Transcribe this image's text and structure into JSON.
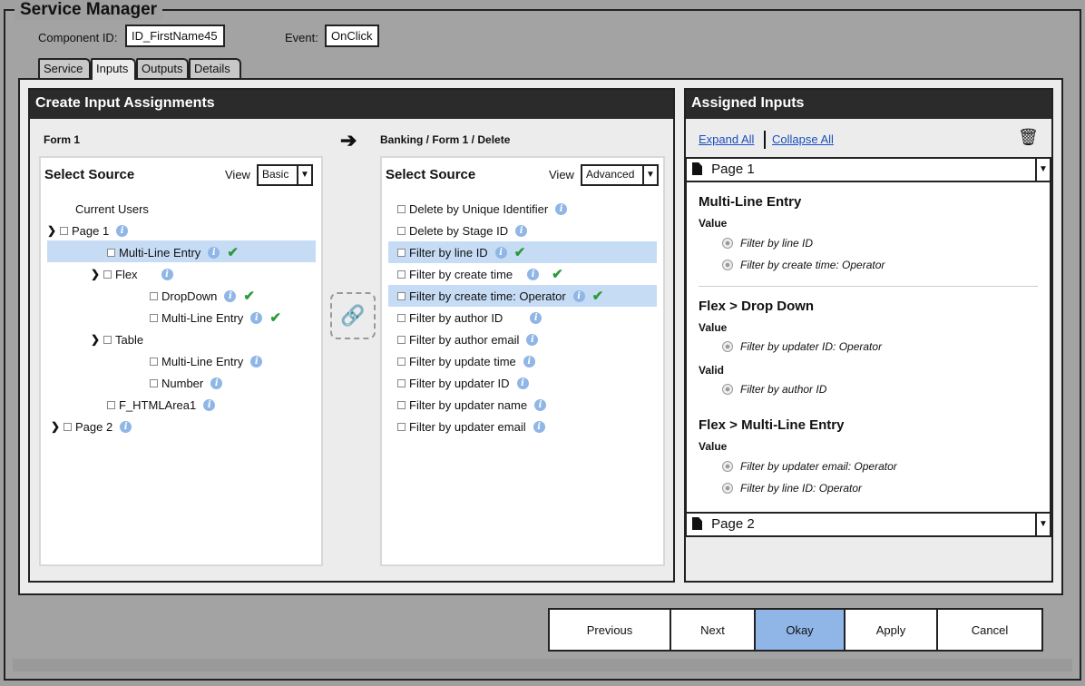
{
  "window": {
    "title": "Service Manager"
  },
  "header": {
    "component_id_label": "Component ID:",
    "component_id_value": "ID_FirstName45",
    "event_label": "Event:",
    "event_value": "OnClick"
  },
  "tabs": [
    {
      "label": "Service"
    },
    {
      "label": "Inputs",
      "active": true
    },
    {
      "label": "Outputs"
    },
    {
      "label": "Details"
    }
  ],
  "create_panel": {
    "title": "Create Input Assignments",
    "left": {
      "form_label": "Form 1",
      "source_title": "Select Source",
      "view_label": "View",
      "view_value": "Basic",
      "root_label": "Current Users",
      "tree": [
        {
          "label": "Page 1"
        },
        {
          "label": "Multi-Line Entry"
        },
        {
          "label": "Flex"
        },
        {
          "label": "DropDown"
        },
        {
          "label": "Multi-Line Entry"
        },
        {
          "label": "Table"
        },
        {
          "label": "Multi-Line Entry"
        },
        {
          "label": "Number"
        },
        {
          "label": "F_HTMLArea1"
        },
        {
          "label": "Page 2"
        }
      ]
    },
    "right": {
      "form_label": "Banking / Form 1 / Delete",
      "source_title": "Select Source",
      "view_label": "View",
      "view_value": "Advanced",
      "items": [
        {
          "label": "Delete by Unique Identifier"
        },
        {
          "label": "Delete by Stage ID"
        },
        {
          "label": "Filter by line ID"
        },
        {
          "label": "Filter by create time"
        },
        {
          "label": "Filter by create time: Operator"
        },
        {
          "label": "Filter by author ID"
        },
        {
          "label": "Filter by author email"
        },
        {
          "label": "Filter by update time"
        },
        {
          "label": "Filter by updater ID"
        },
        {
          "label": "Filter by updater name"
        },
        {
          "label": "Filter by updater email"
        }
      ]
    }
  },
  "assigned_panel": {
    "title": "Assigned Inputs",
    "expand_all": "Expand All",
    "collapse_all": "Collapse All",
    "page1": "Page 1",
    "page2": "Page 2",
    "groups": [
      {
        "heading": "Multi-Line Entry",
        "sections": [
          {
            "label": "Value",
            "items": [
              "Filter by line ID",
              "Filter by create time: Operator"
            ]
          }
        ]
      },
      {
        "heading": "Flex > Drop Down",
        "sections": [
          {
            "label": "Value",
            "items": [
              "Filter by updater ID: Operator"
            ]
          },
          {
            "label": "Valid",
            "items": [
              "Filter by author ID"
            ]
          }
        ]
      },
      {
        "heading": "Flex > Multi-Line Entry",
        "sections": [
          {
            "label": "Value",
            "items": [
              "Filter by updater email: Operator",
              "Filter by line ID: Operator"
            ]
          }
        ]
      }
    ]
  },
  "buttons": {
    "previous": "Previous",
    "next": "Next",
    "okay": "Okay",
    "apply": "Apply",
    "cancel": "Cancel"
  },
  "colors": {
    "highlight": "#c6dcf5",
    "primary": "#8fb6e6",
    "check": "#2b9a3a",
    "header_bg": "#2b2b2b"
  }
}
